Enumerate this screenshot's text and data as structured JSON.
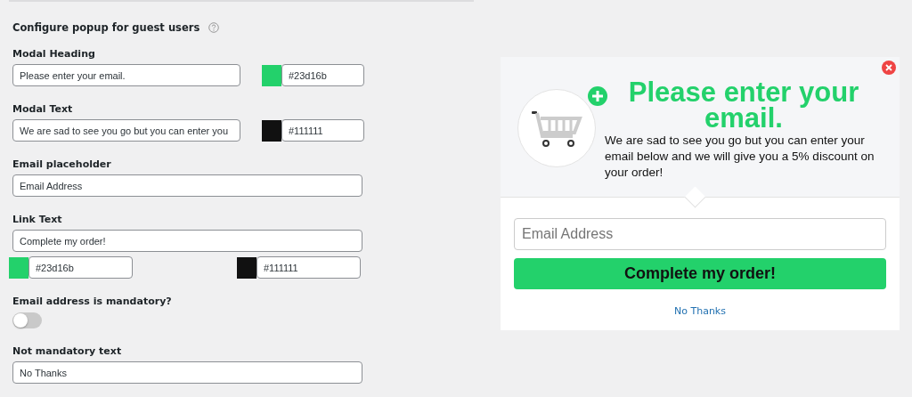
{
  "settings": {
    "title": "Configure popup for guest users",
    "fields": [
      {
        "kind": "text_color",
        "label": "Modal Heading",
        "value": "Please enter your email.",
        "color": "#23d16b",
        "hex": "#23d16b"
      },
      {
        "kind": "text_color",
        "label": "Modal Text",
        "value": "We are sad to see you go but you can enter you",
        "color": "#111111",
        "hex": "#111111"
      },
      {
        "kind": "text",
        "label": "Email placeholder",
        "value": "Email Address"
      },
      {
        "kind": "text_two_colors",
        "label": "Link Text",
        "value": "Complete my order!",
        "colors": [
          {
            "color": "#23d16b",
            "hex": "#23d16b"
          },
          {
            "color": "#111111",
            "hex": "#111111"
          }
        ]
      },
      {
        "kind": "toggle",
        "label": "Email address is mandatory?",
        "on": false
      },
      {
        "kind": "text",
        "label": "Not mandatory text",
        "value": "No Thanks"
      }
    ]
  },
  "preview": {
    "heading": "Please enter your email.",
    "text": "We are sad to see you go but you can enter your email below and we will give you a 5% discount on your order!",
    "email_placeholder": "Email Address",
    "button": "Complete my order!",
    "link": "No Thanks"
  }
}
